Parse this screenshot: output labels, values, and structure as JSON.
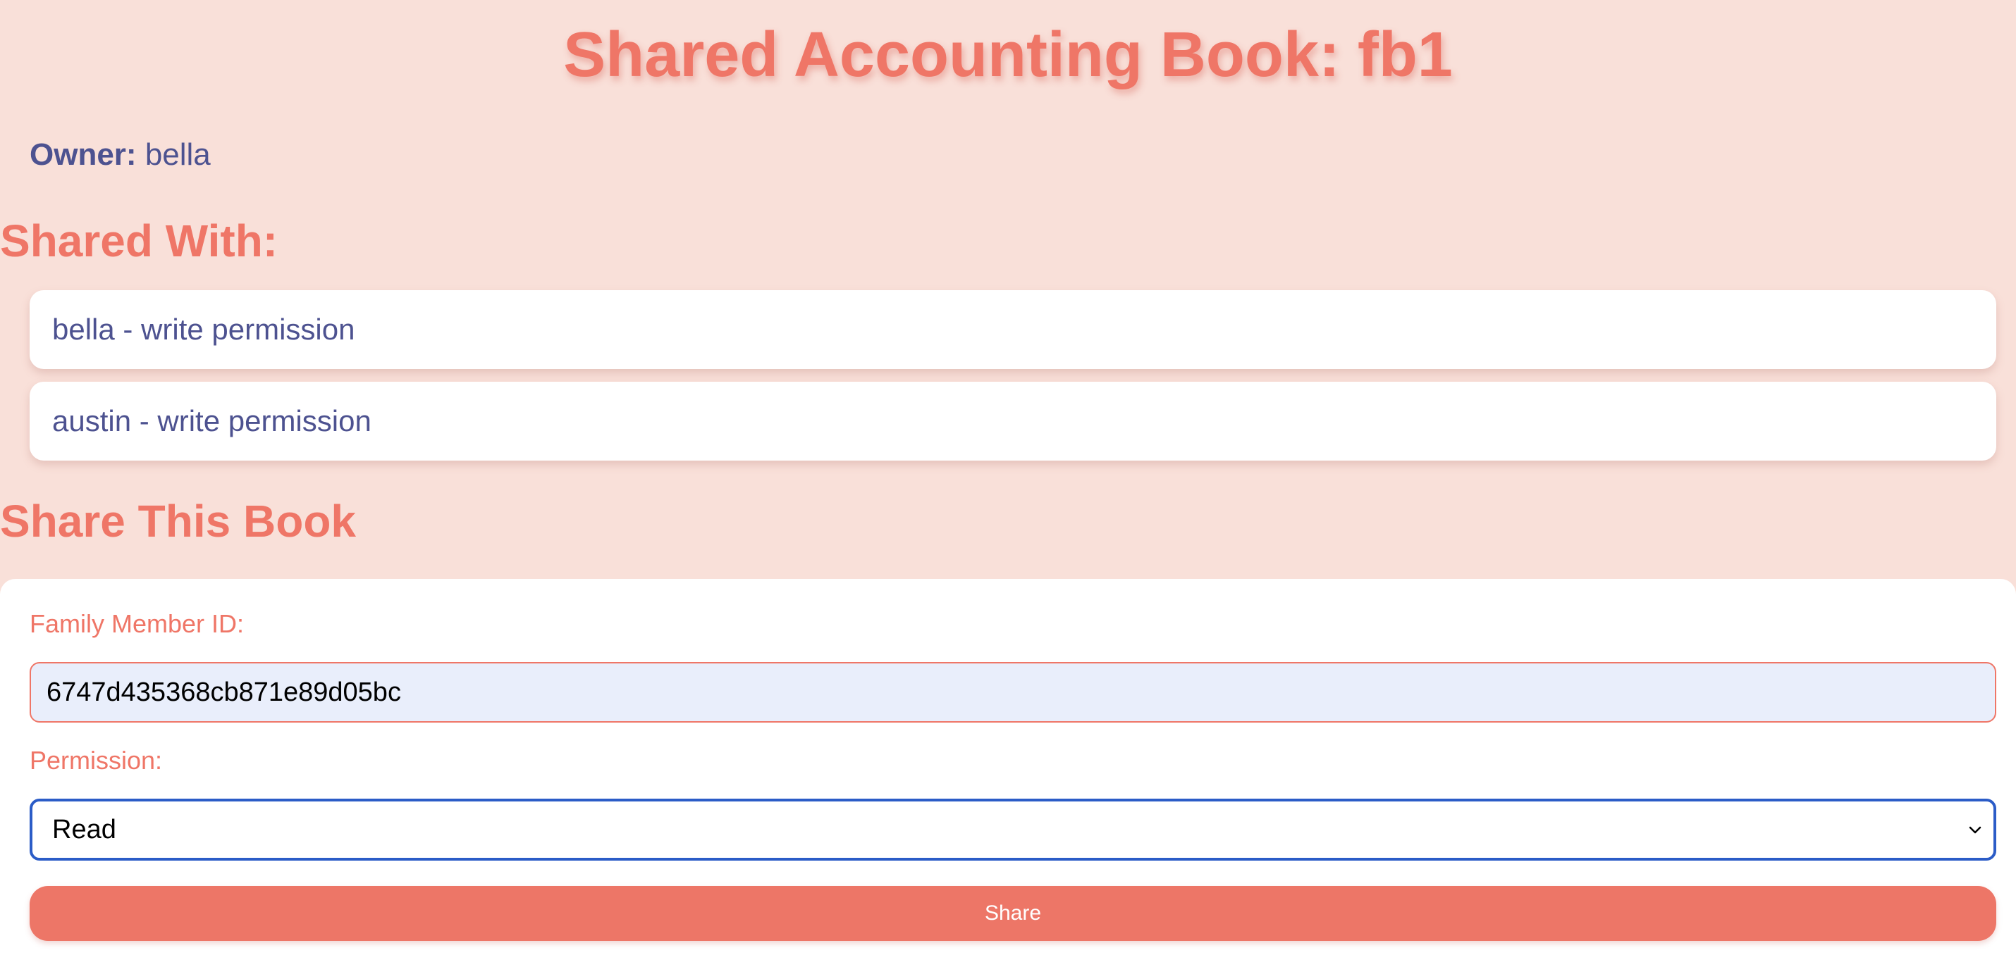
{
  "page": {
    "title": "Shared Accounting Book: fb1"
  },
  "owner": {
    "label": "Owner:",
    "name": "bella"
  },
  "shared_with": {
    "heading": "Shared With:",
    "items": [
      {
        "text": "bella - write permission"
      },
      {
        "text": "austin - write permission"
      }
    ]
  },
  "share_form": {
    "heading": "Share This Book",
    "member_id_label": "Family Member ID:",
    "member_id_value": "6747d435368cb871e89d05bc",
    "permission_label": "Permission:",
    "permission_selected": "Read",
    "submit_label": "Share"
  },
  "colors": {
    "background": "#f9e0d9",
    "accent": "#ef7667",
    "text": "#4d5290",
    "focus_border": "#2b5cc7",
    "input_fill": "#e9eefb"
  },
  "icons": {
    "select_arrow": "chevron-down-icon"
  }
}
